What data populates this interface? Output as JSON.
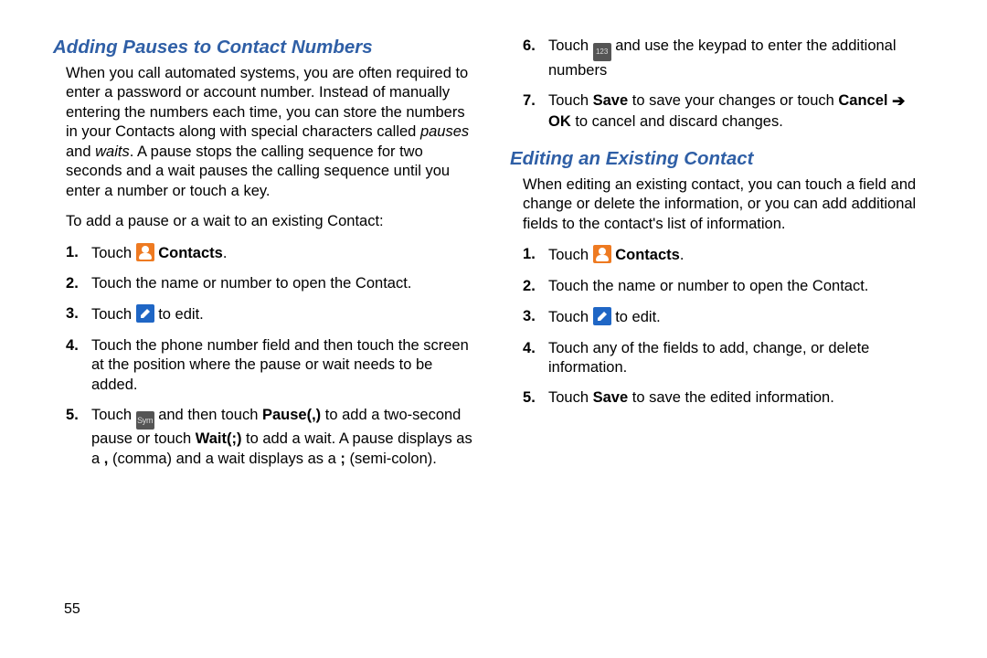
{
  "page_number": "55",
  "left": {
    "heading": "Adding Pauses to Contact Numbers",
    "intro_parts": {
      "a": "When you call automated systems, you are often required to enter a password or account number. Instead of manually entering the numbers each time, you can store the numbers in your Contacts along with special characters called ",
      "pauses": "pauses",
      "b": " and ",
      "waits": "waits",
      "c": ". A pause stops the calling sequence for two seconds and a wait pauses the calling sequence until you enter a number or touch a key."
    },
    "toadd": "To add a pause or a wait to an existing Contact:",
    "step1_touch": "Touch ",
    "step1_contacts": " Contacts",
    "step1_period": ".",
    "step2": "Touch the name or number to open the Contact.",
    "step3_a": "Touch ",
    "step3_b": " to edit.",
    "step4": "Touch the phone number field and then touch the screen at the position where the pause or wait needs to be added.",
    "step5": {
      "a": "Touch ",
      "b": " and then touch ",
      "pause": "Pause(,)",
      "c": " to add a two-second pause or touch ",
      "wait": "Wait(;)",
      "d": " to add a wait. A pause displays as a ",
      "comma": ",",
      "e": " (comma) and a wait displays as a ",
      "semi": ";",
      "f": " (semi-colon)."
    }
  },
  "right": {
    "step6_a": "Touch ",
    "step6_b": " and use the keypad to enter the additional numbers",
    "step7": {
      "a": "Touch ",
      "save": "Save",
      "b": " to save your changes or touch ",
      "cancel": "Cancel",
      "c": " ",
      "ok": "OK",
      "d": " to cancel and discard changes."
    },
    "heading": "Editing an Existing Contact",
    "intro": "When editing an existing contact, you can touch a field and change or delete the information, or you can add additional fields to the contact's list of information.",
    "s1_touch": "Touch ",
    "s1_contacts": " Contacts",
    "s1_period": ".",
    "s2": "Touch the name or number to open the Contact.",
    "s3_a": "Touch ",
    "s3_b": " to edit.",
    "s4": "Touch any of the fields to add, change, or delete information.",
    "s5_a": "Touch ",
    "s5_save": "Save",
    "s5_b": " to save the edited information."
  },
  "icons": {
    "sym_label": "Sym",
    "num_label": "123"
  }
}
